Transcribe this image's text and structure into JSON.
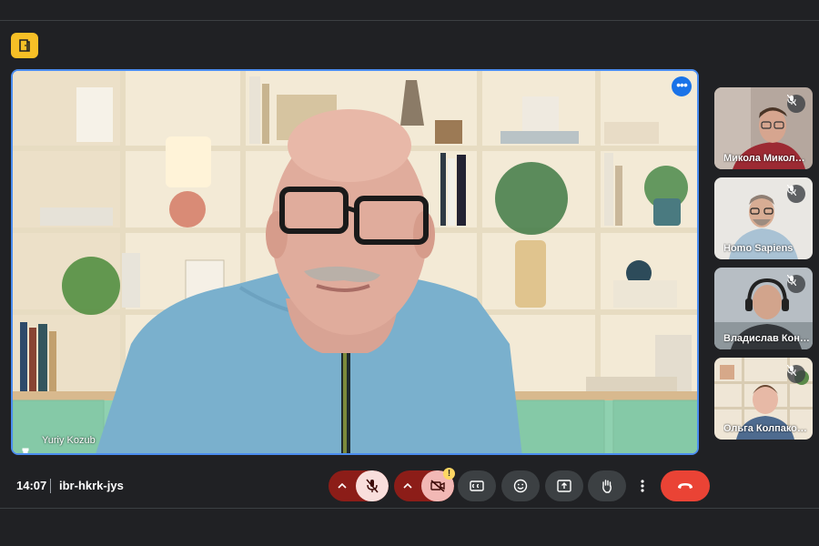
{
  "meeting": {
    "time": "14:07",
    "code": "ibr-hkrk-jys"
  },
  "main_speaker": {
    "name": "Yuriy Kozub"
  },
  "participants": [
    {
      "name": "Микола Микол…"
    },
    {
      "name": "Homo Sapiens"
    },
    {
      "name": "Владислав Кон…"
    },
    {
      "name": "Ольга Колпако…"
    }
  ],
  "controls": {
    "more_dots": "•••",
    "caret": "^",
    "warning": "!"
  },
  "colors": {
    "accent": "#4b8df0",
    "hangup": "#ea4335",
    "mic_off_bg": "#f9dedc",
    "caret_bg": "#8c1d18",
    "logo": "#f6bf26"
  }
}
